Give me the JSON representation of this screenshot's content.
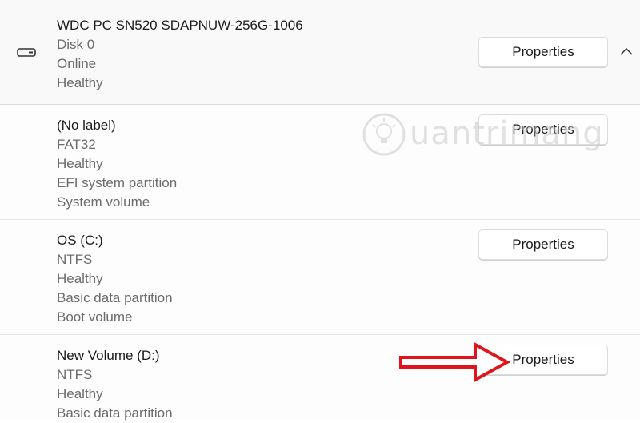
{
  "disk": {
    "lines": [
      "WDC PC SN520 SDAPNUW-256G-1006",
      "Disk 0",
      "Online",
      "Healthy"
    ],
    "button_label": "Properties",
    "icon": "disk-drive-icon",
    "chevron": "chevron-up-icon"
  },
  "partitions": [
    {
      "lines": [
        "(No label)",
        "FAT32",
        "Healthy",
        "EFI system partition",
        "System volume"
      ],
      "button_label": "Properties"
    },
    {
      "lines": [
        "OS (C:)",
        "NTFS",
        "Healthy",
        "Basic data partition",
        "Boot volume"
      ],
      "button_label": "Properties"
    },
    {
      "lines": [
        "New Volume (D:)",
        "NTFS",
        "Healthy",
        "Basic data partition"
      ],
      "button_label": "Properties"
    }
  ],
  "watermark": {
    "text": "uantrimang",
    "icon": "lightbulb-logo-icon"
  },
  "annotation": {
    "icon": "red-arrow-icon",
    "color": "#e0141b"
  }
}
